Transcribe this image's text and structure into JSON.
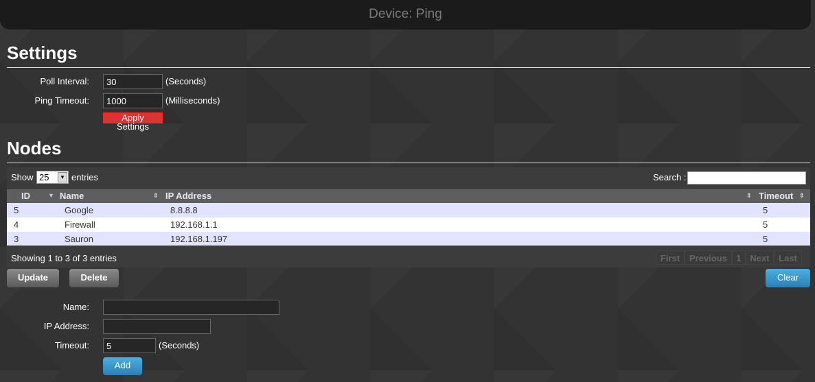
{
  "header": {
    "title": "Device: Ping"
  },
  "settings": {
    "heading": "Settings",
    "poll_label": "Poll Interval:",
    "poll_value": "30",
    "poll_unit": "(Seconds)",
    "timeout_label": "Ping Timeout:",
    "timeout_value": "1000",
    "timeout_unit": "(Milliseconds)",
    "apply_label": "Apply Settings"
  },
  "nodes": {
    "heading": "Nodes",
    "show_label": "Show",
    "entries_value": "25",
    "entries_label": "entries",
    "search_label": "Search :",
    "search_value": "",
    "columns": [
      "ID",
      "Name",
      "IP Address",
      "Timeout"
    ],
    "rows": [
      {
        "id": "5",
        "name": "Google",
        "ip": "8.8.8.8",
        "timeout": "5"
      },
      {
        "id": "4",
        "name": "Firewall",
        "ip": "192.168.1.1",
        "timeout": "5"
      },
      {
        "id": "3",
        "name": "Sauron",
        "ip": "192.168.1.197",
        "timeout": "5"
      }
    ],
    "info": "Showing 1 to 3 of 3 entries",
    "pagination": [
      "First",
      "Previous",
      "1",
      "Next",
      "Last"
    ],
    "update_label": "Update",
    "delete_label": "Delete",
    "clear_label": "Clear"
  },
  "form": {
    "name_label": "Name:",
    "name_value": "",
    "ip_label": "IP Address:",
    "ip_value": "",
    "timeout_label": "Timeout:",
    "timeout_value": "5",
    "timeout_unit": "(Seconds)",
    "add_label": "Add"
  },
  "colors": {
    "accent_blue": "#3399cc",
    "apply_red": "#dd3333",
    "row_odd": "#e2e4ff",
    "row_even": "#ffffff"
  }
}
